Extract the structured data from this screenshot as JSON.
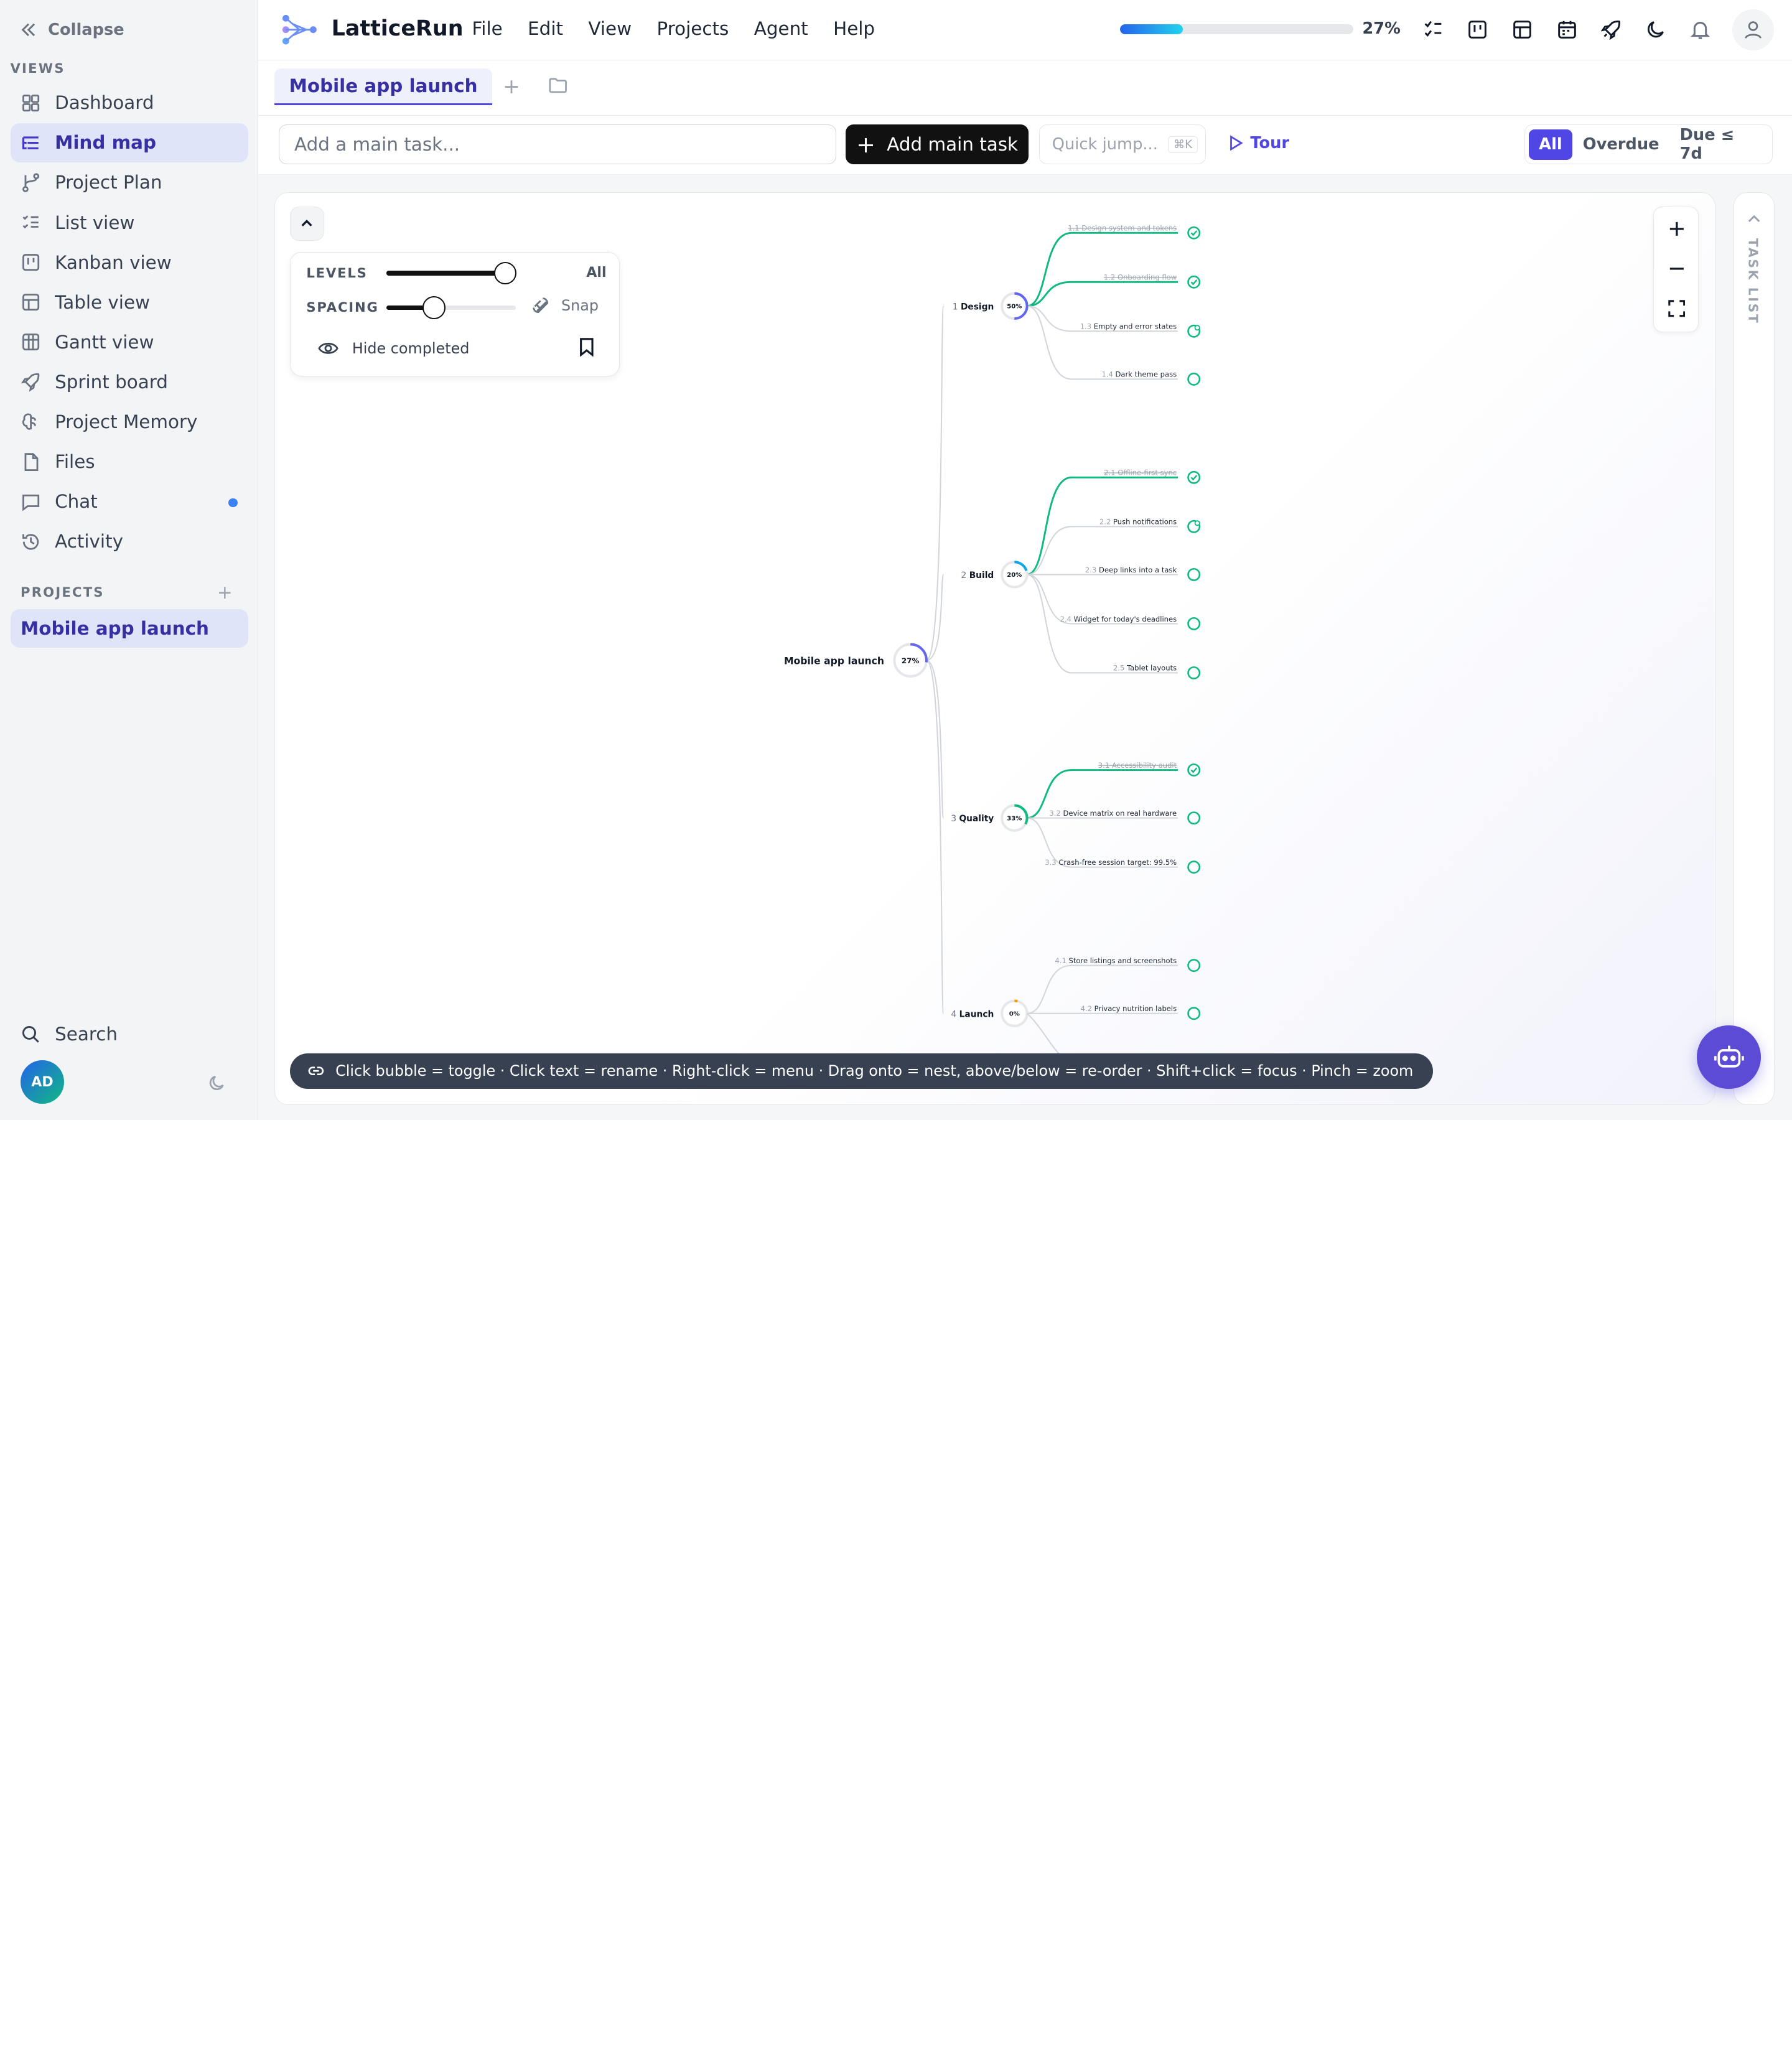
{
  "sidebar": {
    "collapse_label": "Collapse",
    "views_label": "VIEWS",
    "items": [
      {
        "label": "Dashboard",
        "icon": "dashboard-icon"
      },
      {
        "label": "Mind map",
        "icon": "mindmap-icon",
        "active": true
      },
      {
        "label": "Project Plan",
        "icon": "branch-icon"
      },
      {
        "label": "List view",
        "icon": "list-icon"
      },
      {
        "label": "Kanban view",
        "icon": "kanban-icon"
      },
      {
        "label": "Table view",
        "icon": "table-icon"
      },
      {
        "label": "Gantt view",
        "icon": "gantt-icon"
      },
      {
        "label": "Sprint board",
        "icon": "rocket-icon"
      },
      {
        "label": "Project Memory",
        "icon": "brain-icon"
      },
      {
        "label": "Files",
        "icon": "file-icon"
      },
      {
        "label": "Chat",
        "icon": "chat-icon",
        "badge": true
      },
      {
        "label": "Activity",
        "icon": "history-icon"
      }
    ],
    "projects_label": "PROJECTS",
    "projects": [
      "Mobile app launch"
    ],
    "search_label": "Search",
    "avatar_initials": "AD"
  },
  "header": {
    "app_name": "LatticeRun",
    "menu": [
      "File",
      "Edit",
      "View",
      "Projects",
      "Agent",
      "Help"
    ],
    "progress_percent": 27,
    "progress_label": "27%"
  },
  "tabs": {
    "active": "Mobile app launch"
  },
  "toolbar": {
    "task_placeholder": "Add a main task...",
    "add_label": "Add main task",
    "quick_jump_placeholder": "Quick jump...",
    "quick_jump_kbd": "⌘K",
    "tour_label": "Tour",
    "filters": [
      "All",
      "Overdue",
      "Due ≤ 7d"
    ],
    "active_filter": "All"
  },
  "controls": {
    "levels_label": "LEVELS",
    "levels_value": "All",
    "levels_fraction": 0.92,
    "spacing_label": "SPACING",
    "spacing_fraction": 0.37,
    "snap_label": "Snap",
    "hide_completed_label": "Hide completed"
  },
  "mindmap": {
    "root": {
      "label": "Mobile app launch",
      "progress": "27%"
    },
    "groups": [
      {
        "num": "1",
        "label": "Design",
        "progress": "50%",
        "color": "#6366f1",
        "tasks": [
          {
            "num": "1.1",
            "label": "Design system and tokens",
            "done": true
          },
          {
            "num": "1.2",
            "label": "Onboarding flow",
            "done": true
          },
          {
            "num": "1.3",
            "label": "Empty and error states",
            "done": false,
            "partial": true
          },
          {
            "num": "1.4",
            "label": "Dark theme pass",
            "done": false
          }
        ]
      },
      {
        "num": "2",
        "label": "Build",
        "progress": "20%",
        "color": "#0ea5e9",
        "tasks": [
          {
            "num": "2.1",
            "label": "Offline-first sync",
            "done": true
          },
          {
            "num": "2.2",
            "label": "Push notifications",
            "done": false,
            "partial": true
          },
          {
            "num": "2.3",
            "label": "Deep links into a task",
            "done": false
          },
          {
            "num": "2.4",
            "label": "Widget for today's deadlines",
            "done": false
          },
          {
            "num": "2.5",
            "label": "Tablet layouts",
            "done": false
          }
        ]
      },
      {
        "num": "3",
        "label": "Quality",
        "progress": "33%",
        "color": "#10b981",
        "tasks": [
          {
            "num": "3.1",
            "label": "Accessibility audit",
            "done": true
          },
          {
            "num": "3.2",
            "label": "Device matrix on real hardware",
            "done": false
          },
          {
            "num": "3.3",
            "label": "Crash-free session target: 99.5%",
            "done": false
          }
        ]
      },
      {
        "num": "4",
        "label": "Launch",
        "progress": "0%",
        "color": "#f59e0b",
        "tasks": [
          {
            "num": "4.1",
            "label": "Store listings and screenshots",
            "done": false
          },
          {
            "num": "4.2",
            "label": "Privacy nutrition labels",
            "done": false
          }
        ]
      }
    ]
  },
  "hint": "Click bubble = toggle · Click text = rename · Right-click = menu · Drag onto = nest, above/below = re-order · Shift+click = focus · Pinch = zoom",
  "task_list_label": "TASK LIST",
  "colors": {
    "accent": "#4f46e5",
    "done": "#10b981"
  }
}
